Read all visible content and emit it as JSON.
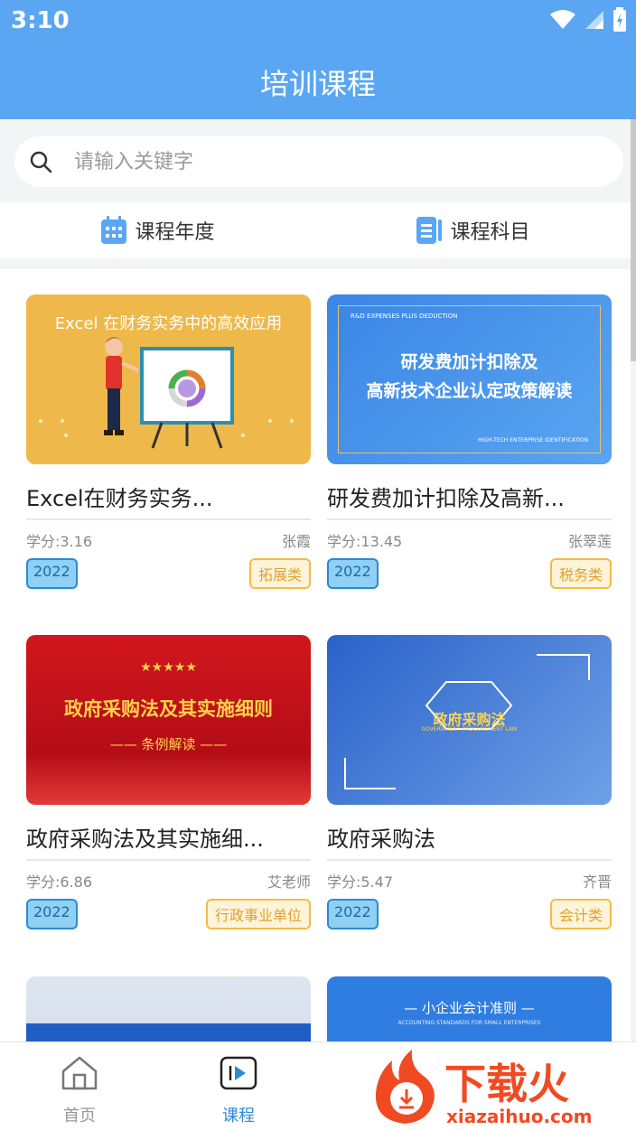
{
  "status": {
    "time": "3:10"
  },
  "header": {
    "title": "培训课程"
  },
  "search": {
    "placeholder": "请输入关键字"
  },
  "filters": [
    {
      "label": "课程年度",
      "icon": "calendar-icon"
    },
    {
      "label": "课程科目",
      "icon": "list-icon"
    }
  ],
  "courses": [
    {
      "name": "Excel在财务实务...",
      "credit": "学分:3.16",
      "teacher": "张霞",
      "year": "2022",
      "category": "拓展类",
      "thumb": {
        "bg": "#eeb94a",
        "title": "Excel 在财务实务中的高效应用"
      }
    },
    {
      "name": "研发费加计扣除及高新...",
      "credit": "学分:13.45",
      "teacher": "张翠莲",
      "year": "2022",
      "category": "税务类",
      "thumb": {
        "bg": "#3e8ee8",
        "kicker": "R&D EXPENSES PLUS DEDUCTION",
        "line1": "研发费加计扣除及",
        "line2": "高新技术企业认定政策解读",
        "footer": "HIGH-TECH ENTERPRISE IDENTIFICATION"
      }
    },
    {
      "name": "政府采购法及其实施细...",
      "credit": "学分:6.86",
      "teacher": "艾老师",
      "year": "2022",
      "category": "行政事业单位",
      "thumb": {
        "bg": "#c8161d",
        "stars": "★★★★★",
        "title": "政府采购法及其实施细则",
        "sub": "—— 条例解读 ——"
      }
    },
    {
      "name": "政府采购法",
      "credit": "学分:5.47",
      "teacher": "齐晋",
      "year": "2022",
      "category": "会计类",
      "thumb": {
        "bg": "#2f6fd1",
        "title": "政府采购法",
        "sub": "GOVERNMENT PROCUREMENT LAW"
      }
    },
    {
      "thumb": {
        "bg": "#cfd8e6"
      }
    },
    {
      "thumb": {
        "bg": "#2f7de0",
        "title": "— 小企业会计准则 —",
        "sub": "ACCOUNTING STANDARDS FOR SMALL ENTERPRISES"
      }
    }
  ],
  "tabbar": [
    {
      "label": "首页",
      "icon": "home-icon",
      "active": false
    },
    {
      "label": "课程",
      "icon": "play-icon",
      "active": true
    }
  ],
  "watermark": {
    "brand": "下载火",
    "url": "xiazaihuo.com"
  },
  "colors": {
    "primary": "#5aa6f2",
    "active_tab": "#2b8ad6",
    "tag_year": "#2b8ad6",
    "tag_category": "#f5bb45"
  }
}
